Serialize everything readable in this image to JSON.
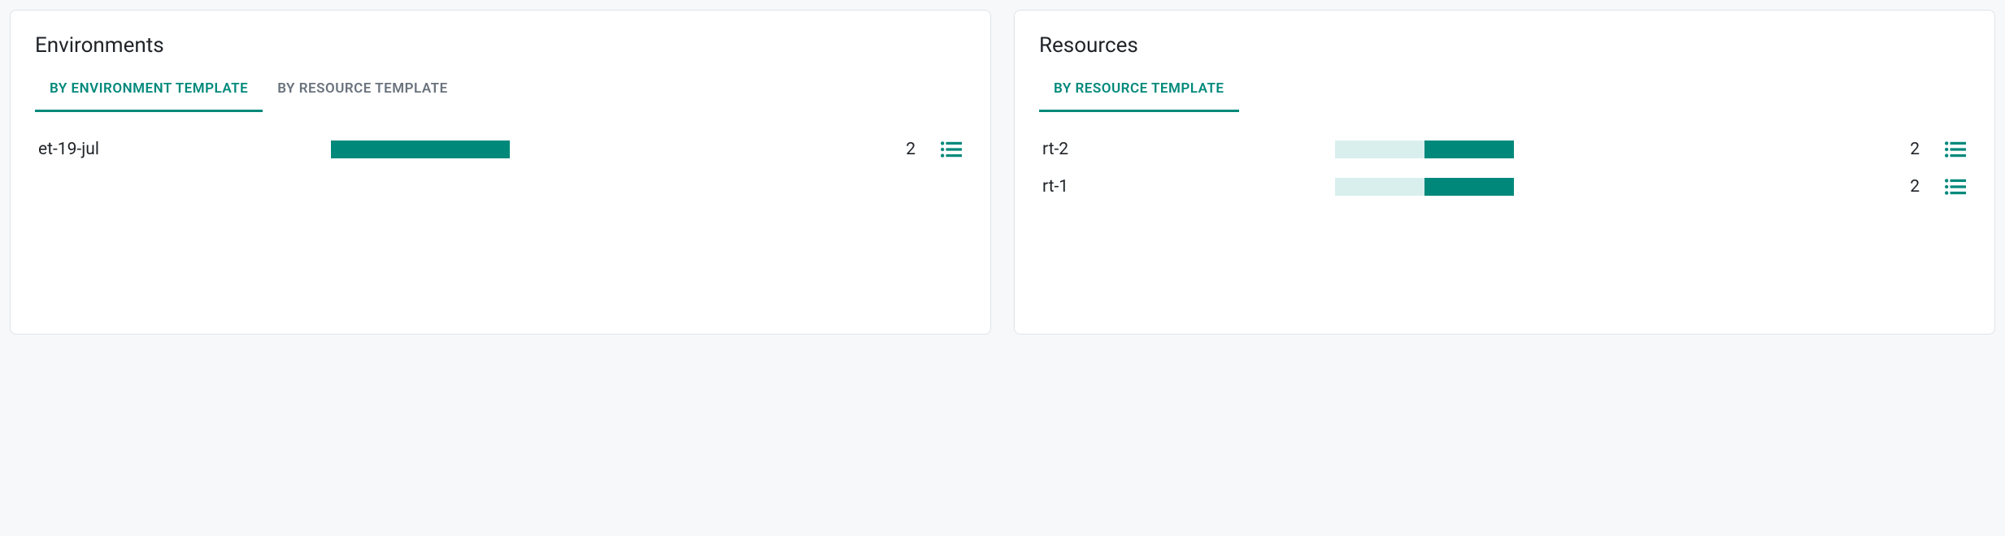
{
  "colors": {
    "accent": "#00897B",
    "accentLight": "#d9efed"
  },
  "panels": {
    "environments": {
      "title": "Environments",
      "tabs": [
        {
          "label": "BY ENVIRONMENT TEMPLATE",
          "active": true
        },
        {
          "label": "BY RESOURCE TEMPLATE",
          "active": false
        }
      ],
      "rows": [
        {
          "label": "et-19-jul",
          "count": "2",
          "fillPercent": 100,
          "hasBg": false
        }
      ]
    },
    "resources": {
      "title": "Resources",
      "tabs": [
        {
          "label": "BY RESOURCE TEMPLATE",
          "active": true
        }
      ],
      "rows": [
        {
          "label": "rt-2",
          "count": "2",
          "fillPercent": 50,
          "hasBg": true
        },
        {
          "label": "rt-1",
          "count": "2",
          "fillPercent": 50,
          "hasBg": true
        }
      ]
    }
  }
}
